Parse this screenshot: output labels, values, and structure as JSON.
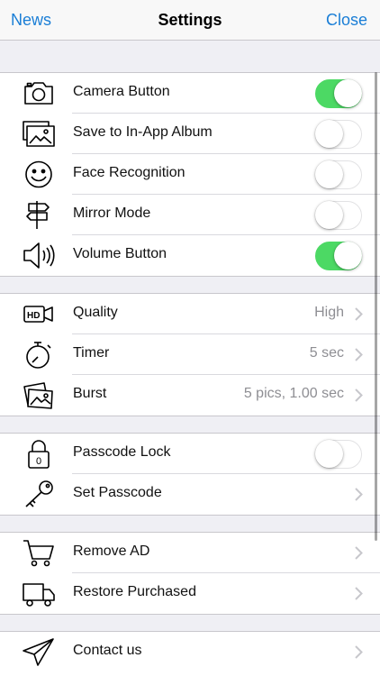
{
  "navbar": {
    "left_label": "News",
    "title": "Settings",
    "right_label": "Close"
  },
  "colors": {
    "accent": "#1a7ed6",
    "toggle_on": "#4cd964",
    "secondary_text": "#8e8e93"
  },
  "sections": [
    {
      "rows": [
        {
          "icon": "camera-icon",
          "label": "Camera Button",
          "toggle": true
        },
        {
          "icon": "photo-album-icon",
          "label": "Save to In-App Album",
          "toggle": false
        },
        {
          "icon": "smiley-face-icon",
          "label": "Face Recognition",
          "toggle": false
        },
        {
          "icon": "signpost-icon",
          "label": "Mirror Mode",
          "toggle": false
        },
        {
          "icon": "speaker-icon",
          "label": "Volume Button",
          "toggle": true
        }
      ]
    },
    {
      "rows": [
        {
          "icon": "hd-video-icon",
          "label": "Quality",
          "value": "High"
        },
        {
          "icon": "stopwatch-icon",
          "label": "Timer",
          "value": "5 sec"
        },
        {
          "icon": "burst-photos-icon",
          "label": "Burst",
          "value": "5 pics, 1.00 sec"
        }
      ]
    },
    {
      "rows": [
        {
          "icon": "padlock-icon",
          "label": "Passcode Lock",
          "toggle": false
        },
        {
          "icon": "key-icon",
          "label": "Set Passcode"
        }
      ]
    },
    {
      "rows": [
        {
          "icon": "shopping-cart-icon",
          "label": "Remove AD"
        },
        {
          "icon": "delivery-truck-icon",
          "label": "Restore Purchased"
        }
      ]
    },
    {
      "rows": [
        {
          "icon": "paper-plane-icon",
          "label": "Contact us"
        }
      ]
    }
  ]
}
